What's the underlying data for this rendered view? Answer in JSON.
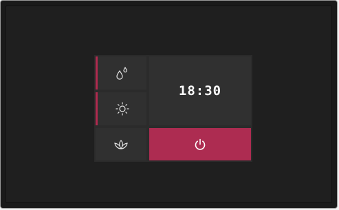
{
  "display": {
    "time": "18:30"
  },
  "controls": [
    {
      "id": "water",
      "icon": "water-drops-icon",
      "active": true
    },
    {
      "id": "sun",
      "icon": "sun-icon",
      "active": true
    },
    {
      "id": "leaf",
      "icon": "lotus-leaf-icon",
      "active": false
    },
    {
      "id": "power",
      "icon": "power-icon"
    }
  ],
  "colors": {
    "accent": "#ad2c51",
    "panel": "#2b2b2b",
    "tile": "#303030",
    "background": "#1f1f1f"
  }
}
